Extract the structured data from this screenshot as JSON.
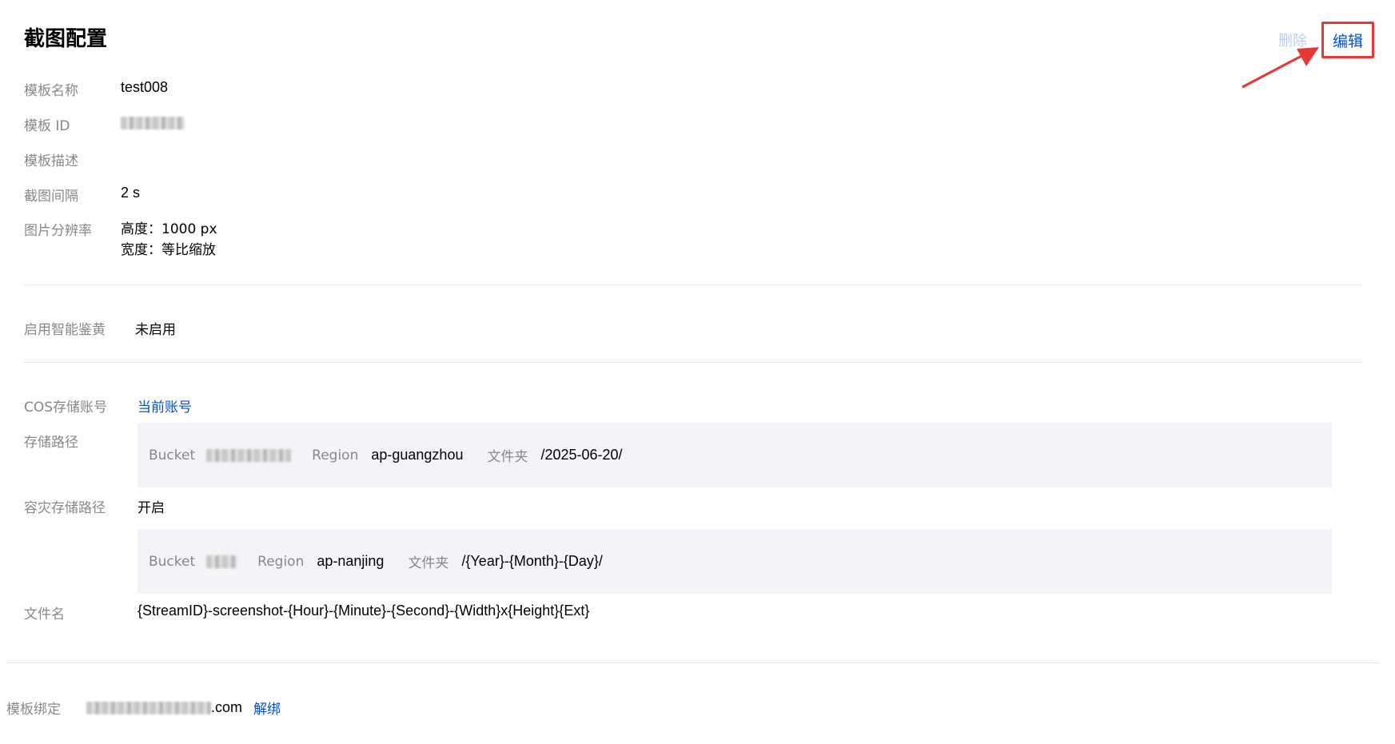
{
  "header": {
    "title": "截图配置",
    "delete_label": "删除",
    "edit_label": "编辑"
  },
  "basic": {
    "name_label": "模板名称",
    "name_value": "test008",
    "id_label": "模板 ID",
    "desc_label": "模板描述",
    "interval_label": "截图间隔",
    "interval_value": "2 s",
    "resolution_label": "图片分辨率",
    "height_value": "高度：1000 px",
    "width_value": "宽度：等比缩放"
  },
  "porn": {
    "label": "启用智能鉴黄",
    "value": "未启用"
  },
  "storage": {
    "cos_label": "COS存储账号",
    "cos_value": "当前账号",
    "path_label": "存储路径",
    "path": {
      "bucket_label": "Bucket",
      "region_label": "Region",
      "region_value": "ap-guangzhou",
      "folder_label": "文件夹",
      "folder_value": "/2025-06-20/"
    },
    "dr_label": "容灾存储路径",
    "dr_value": "开启",
    "dr_path": {
      "bucket_label": "Bucket",
      "region_label": "Region",
      "region_value": "ap-nanjing",
      "folder_label": "文件夹",
      "folder_value": "/{Year}-{Month}-{Day}/"
    },
    "filename_label": "文件名",
    "filename_value": "{StreamID}-screenshot-{Hour}-{Minute}-{Second}-{Width}x{Height}{Ext}"
  },
  "binding": {
    "label": "模板绑定",
    "domain_suffix": ".com",
    "unbind_label": "解绑"
  },
  "colors": {
    "link": "#0052d9",
    "label": "#888888",
    "highlight": "#e53935",
    "path_bg": "#f3f4f7"
  }
}
